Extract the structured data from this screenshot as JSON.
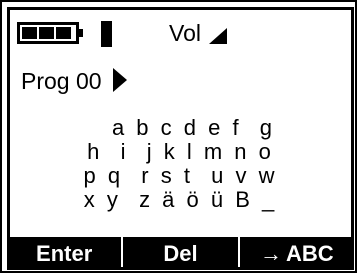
{
  "status": {
    "battery_icon": "battery-icon",
    "signal_icon": "signal-bar-icon",
    "volume_label": "Vol",
    "volume_icon": "volume-triangle-icon"
  },
  "program": {
    "label": "Prog 00",
    "arrow_icon": "play-arrow-icon"
  },
  "char_rows": [
    "a b c d e f  g",
    "h  i  j k l m n o",
    "p q  r s t  u v w",
    "x y  z ä ö ü B _"
  ],
  "softkeys": {
    "enter": "Enter",
    "del": "Del",
    "abc_arrow": "→",
    "abc": "ABC"
  },
  "colors": {
    "foreground": "#000000",
    "background": "#ffffff"
  }
}
